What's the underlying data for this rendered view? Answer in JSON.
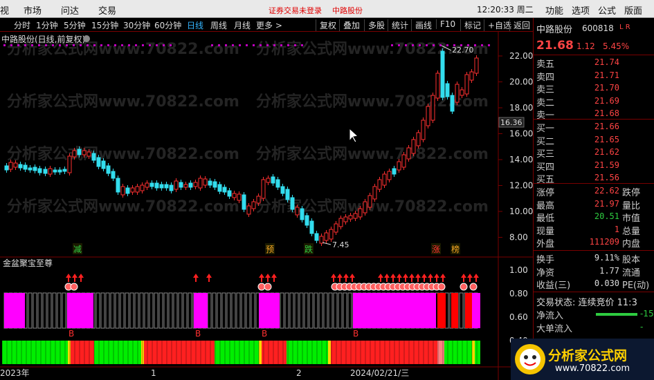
{
  "topbar": {
    "items": [
      "视",
      "市场",
      "问达",
      "交易"
    ],
    "login_notice": "证券交易未登录",
    "stock": "中路股份",
    "time": "12:20:33 周二",
    "right_tabs": [
      "功能",
      "选项",
      "公式",
      "版面"
    ]
  },
  "toolbar": {
    "periods": [
      "分时",
      "1分钟",
      "5分钟",
      "15分钟",
      "30分钟",
      "60分钟",
      "日线",
      "周线",
      "月线",
      "更多 >"
    ],
    "selected": "日线",
    "buttons": [
      "复权",
      "叠加",
      "多股",
      "统计",
      "画线",
      "F10",
      "标记",
      "+自选",
      "返回"
    ]
  },
  "chart": {
    "title": "中路股份(日线,前复权)",
    "watermark": "分析家公式网www.70822.com",
    "price_axis": [
      "22.00",
      "20.00",
      "18.00",
      "16.00",
      "14.00",
      "12.00",
      "10.00",
      "8.00"
    ],
    "cursor_price": "16.36",
    "high_label": "22.70",
    "low_label": "7.45",
    "signal_labels": [
      "减",
      "预",
      "跌",
      "涨",
      "榜"
    ],
    "indicator_name": "金盆聚宝至尊",
    "indicator_axis": [
      "1.00",
      "0.80",
      "0.60",
      "0.40"
    ],
    "buy_labels": [
      "B",
      "B",
      "B",
      "B"
    ],
    "date_axis": [
      "2023年",
      "1",
      "2",
      "2024/02/21/三"
    ]
  },
  "quote": {
    "name": "中路股份",
    "code": "600818",
    "tag": "L R",
    "price": "21.68",
    "change": "1.12",
    "pct": "5.45%",
    "asks": [
      {
        "label": "卖五",
        "price": "21.74"
      },
      {
        "label": "卖四",
        "price": "21.71"
      },
      {
        "label": "卖三",
        "price": "21.70"
      },
      {
        "label": "卖二",
        "price": "21.69"
      },
      {
        "label": "卖一",
        "price": "21.68"
      }
    ],
    "bids": [
      {
        "label": "买一",
        "price": "21.66"
      },
      {
        "label": "买二",
        "price": "21.65"
      },
      {
        "label": "买三",
        "price": "21.62"
      },
      {
        "label": "买四",
        "price": "21.59"
      },
      {
        "label": "买五",
        "price": "21.56"
      }
    ],
    "stats": [
      {
        "label": "涨停",
        "value": "22.62",
        "label2": "跌停"
      },
      {
        "label": "最高",
        "value": "21.97",
        "label2": "量比"
      },
      {
        "label": "最低",
        "value": "20.51",
        "label2": "市值"
      },
      {
        "label": "现量",
        "value": "1",
        "label2": "总量"
      },
      {
        "label": "外盘",
        "value": "111209",
        "label2": "内盘"
      }
    ],
    "stats2": [
      {
        "label": "换手",
        "value": "9.11%",
        "label2": "股本"
      },
      {
        "label": "净资",
        "value": "1.77",
        "label2": "流通"
      },
      {
        "label": "收益(三)",
        "value": "0.030",
        "label2": "PE(动)"
      }
    ],
    "status": "交易状态: 连续竞价 11:3",
    "flows": [
      {
        "label": "净流入",
        "value": "-15"
      },
      {
        "label": "大单流入",
        "value": "-"
      }
    ]
  },
  "logo": {
    "text": "分析家公式网",
    "url": "www.70822.com"
  }
}
